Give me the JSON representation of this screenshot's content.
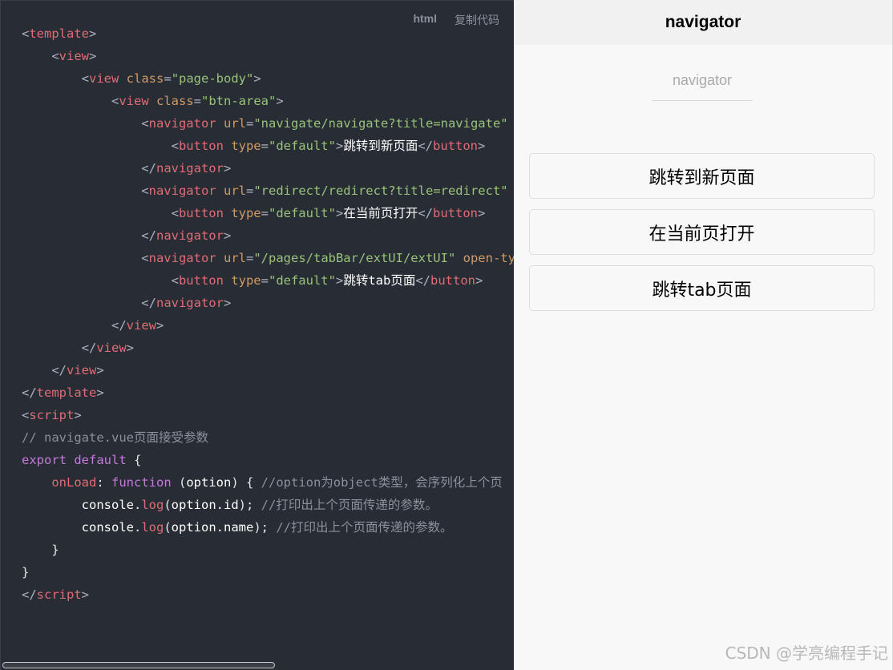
{
  "code_panel": {
    "toolbar": {
      "language": "html",
      "copy_label": "复制代码"
    },
    "lines": [
      [
        [
          "t-punc",
          "<"
        ],
        [
          "t-tag",
          "template"
        ],
        [
          "t-punc",
          ">"
        ]
      ],
      [
        [
          "t-punc",
          "    <"
        ],
        [
          "t-tag",
          "view"
        ],
        [
          "t-punc",
          ">"
        ]
      ],
      [
        [
          "t-punc",
          "        <"
        ],
        [
          "t-tag",
          "view"
        ],
        [
          "t-punc",
          " "
        ],
        [
          "t-attr",
          "class"
        ],
        [
          "t-punc",
          "="
        ],
        [
          "t-str",
          "\"page-body\""
        ],
        [
          "t-punc",
          ">"
        ]
      ],
      [
        [
          "t-punc",
          "            <"
        ],
        [
          "t-tag",
          "view"
        ],
        [
          "t-punc",
          " "
        ],
        [
          "t-attr",
          "class"
        ],
        [
          "t-punc",
          "="
        ],
        [
          "t-str",
          "\"btn-area\""
        ],
        [
          "t-punc",
          ">"
        ]
      ],
      [
        [
          "t-punc",
          "                <"
        ],
        [
          "t-tag",
          "navigator"
        ],
        [
          "t-punc",
          " "
        ],
        [
          "t-attr",
          "url"
        ],
        [
          "t-punc",
          "="
        ],
        [
          "t-str",
          "\"navigate/navigate?title=navigate\""
        ]
      ],
      [
        [
          "t-punc",
          "                    <"
        ],
        [
          "t-tag",
          "button"
        ],
        [
          "t-punc",
          " "
        ],
        [
          "t-attr",
          "type"
        ],
        [
          "t-punc",
          "="
        ],
        [
          "t-str",
          "\"default\""
        ],
        [
          "t-punc",
          ">"
        ],
        [
          "t-txt",
          "跳转到新页面"
        ],
        [
          "t-punc",
          "</"
        ],
        [
          "t-tag",
          "button"
        ],
        [
          "t-punc",
          ">"
        ]
      ],
      [
        [
          "t-punc",
          "                </"
        ],
        [
          "t-tag",
          "navigator"
        ],
        [
          "t-punc",
          ">"
        ]
      ],
      [
        [
          "t-punc",
          "                <"
        ],
        [
          "t-tag",
          "navigator"
        ],
        [
          "t-punc",
          " "
        ],
        [
          "t-attr",
          "url"
        ],
        [
          "t-punc",
          "="
        ],
        [
          "t-str",
          "\"redirect/redirect?title=redirect\""
        ]
      ],
      [
        [
          "t-punc",
          "                    <"
        ],
        [
          "t-tag",
          "button"
        ],
        [
          "t-punc",
          " "
        ],
        [
          "t-attr",
          "type"
        ],
        [
          "t-punc",
          "="
        ],
        [
          "t-str",
          "\"default\""
        ],
        [
          "t-punc",
          ">"
        ],
        [
          "t-txt",
          "在当前页打开"
        ],
        [
          "t-punc",
          "</"
        ],
        [
          "t-tag",
          "button"
        ],
        [
          "t-punc",
          ">"
        ]
      ],
      [
        [
          "t-punc",
          "                </"
        ],
        [
          "t-tag",
          "navigator"
        ],
        [
          "t-punc",
          ">"
        ]
      ],
      [
        [
          "t-punc",
          "                <"
        ],
        [
          "t-tag",
          "navigator"
        ],
        [
          "t-punc",
          " "
        ],
        [
          "t-attr",
          "url"
        ],
        [
          "t-punc",
          "="
        ],
        [
          "t-str",
          "\"/pages/tabBar/extUI/extUI\""
        ],
        [
          "t-punc",
          " "
        ],
        [
          "t-attr",
          "open-ty"
        ]
      ],
      [
        [
          "t-punc",
          "                    <"
        ],
        [
          "t-tag",
          "button"
        ],
        [
          "t-punc",
          " "
        ],
        [
          "t-attr",
          "type"
        ],
        [
          "t-punc",
          "="
        ],
        [
          "t-str",
          "\"default\""
        ],
        [
          "t-punc",
          ">"
        ],
        [
          "t-txt",
          "跳转tab页面"
        ],
        [
          "t-punc",
          "</"
        ],
        [
          "t-tag",
          "button"
        ],
        [
          "t-punc",
          ">"
        ]
      ],
      [
        [
          "t-punc",
          "                </"
        ],
        [
          "t-tag",
          "navigator"
        ],
        [
          "t-punc",
          ">"
        ]
      ],
      [
        [
          "t-punc",
          "            </"
        ],
        [
          "t-tag",
          "view"
        ],
        [
          "t-punc",
          ">"
        ]
      ],
      [
        [
          "t-punc",
          "        </"
        ],
        [
          "t-tag",
          "view"
        ],
        [
          "t-punc",
          ">"
        ]
      ],
      [
        [
          "t-punc",
          "    </"
        ],
        [
          "t-tag",
          "view"
        ],
        [
          "t-punc",
          ">"
        ]
      ],
      [
        [
          "t-punc",
          "</"
        ],
        [
          "t-tag",
          "template"
        ],
        [
          "t-punc",
          ">"
        ]
      ],
      [
        [
          "t-punc",
          "<"
        ],
        [
          "t-tag",
          "script"
        ],
        [
          "t-punc",
          ">"
        ]
      ],
      [
        [
          "t-com",
          "// navigate.vue页面接受参数"
        ]
      ],
      [
        [
          "t-kw",
          "export default"
        ],
        [
          "t-plain",
          " {"
        ]
      ],
      [
        [
          "t-plain",
          "    "
        ],
        [
          "t-fn",
          "onLoad"
        ],
        [
          "t-plain",
          ": "
        ],
        [
          "t-kw",
          "function"
        ],
        [
          "t-plain",
          " ("
        ],
        [
          "t-var",
          "option"
        ],
        [
          "t-plain",
          ") { "
        ],
        [
          "t-com",
          "//option为object类型，会序列化上个页"
        ]
      ],
      [
        [
          "t-plain",
          "        "
        ],
        [
          "t-var",
          "console"
        ],
        [
          "t-plain",
          "."
        ],
        [
          "t-call",
          "log"
        ],
        [
          "t-plain",
          "("
        ],
        [
          "t-var",
          "option.id"
        ],
        [
          "t-plain",
          "); "
        ],
        [
          "t-com",
          "//打印出上个页面传递的参数。"
        ]
      ],
      [
        [
          "t-plain",
          "        "
        ],
        [
          "t-var",
          "console"
        ],
        [
          "t-plain",
          "."
        ],
        [
          "t-call",
          "log"
        ],
        [
          "t-plain",
          "("
        ],
        [
          "t-var",
          "option.name"
        ],
        [
          "t-plain",
          "); "
        ],
        [
          "t-com",
          "//打印出上个页面传递的参数。"
        ]
      ],
      [
        [
          "t-plain",
          "    }"
        ]
      ],
      [
        [
          "t-plain",
          "}"
        ]
      ],
      [
        [
          "t-punc",
          "</"
        ],
        [
          "t-tag",
          "script"
        ],
        [
          "t-punc",
          ">"
        ]
      ]
    ]
  },
  "preview": {
    "nav_title": "navigator",
    "page_head_title": "navigator",
    "buttons": [
      {
        "label": "跳转到新页面"
      },
      {
        "label": "在当前页打开"
      },
      {
        "label": "跳转tab页面"
      }
    ]
  },
  "watermark": "CSDN @学亮编程手记"
}
